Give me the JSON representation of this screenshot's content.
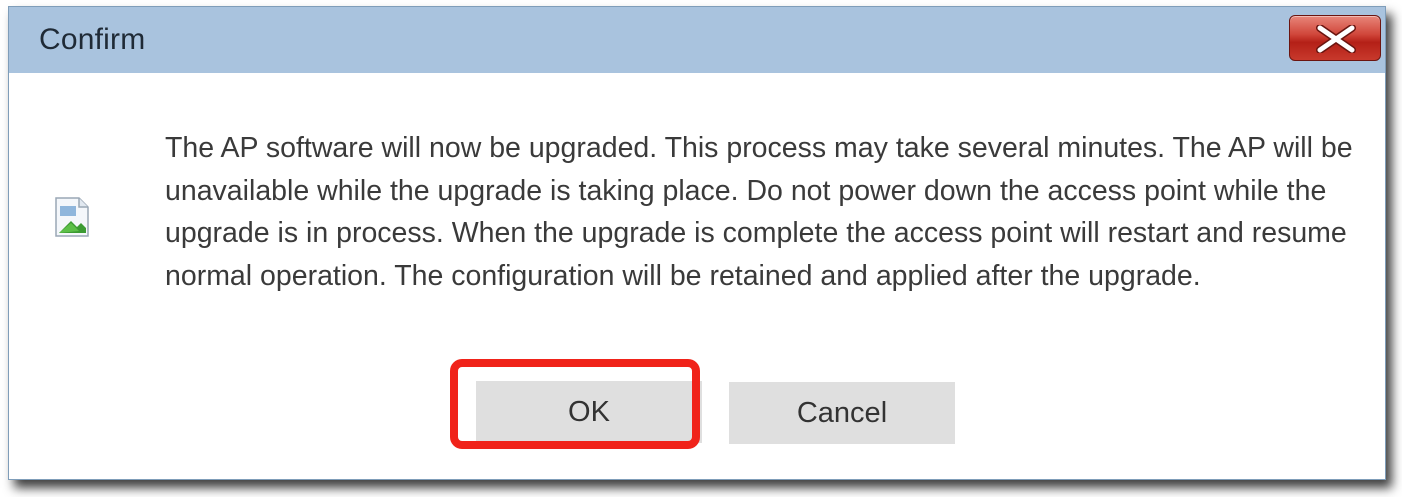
{
  "dialog": {
    "title": "Confirm",
    "close_icon": "close-x-icon",
    "message_icon": "broken-image-icon",
    "message": "The AP software will now be upgraded. This process may take several minutes. The AP will be unavailable while the upgrade is taking place. Do not power down the access point while the upgrade is in process. When the upgrade is complete the access point will restart and resume normal operation. The configuration will be retained and applied after the upgrade.",
    "ok_label": "OK",
    "cancel_label": "Cancel"
  },
  "colors": {
    "titlebar": "#a9c3de",
    "close_button": "#c8392c",
    "button": "#dfdfdf",
    "highlight": "#f0231a"
  }
}
